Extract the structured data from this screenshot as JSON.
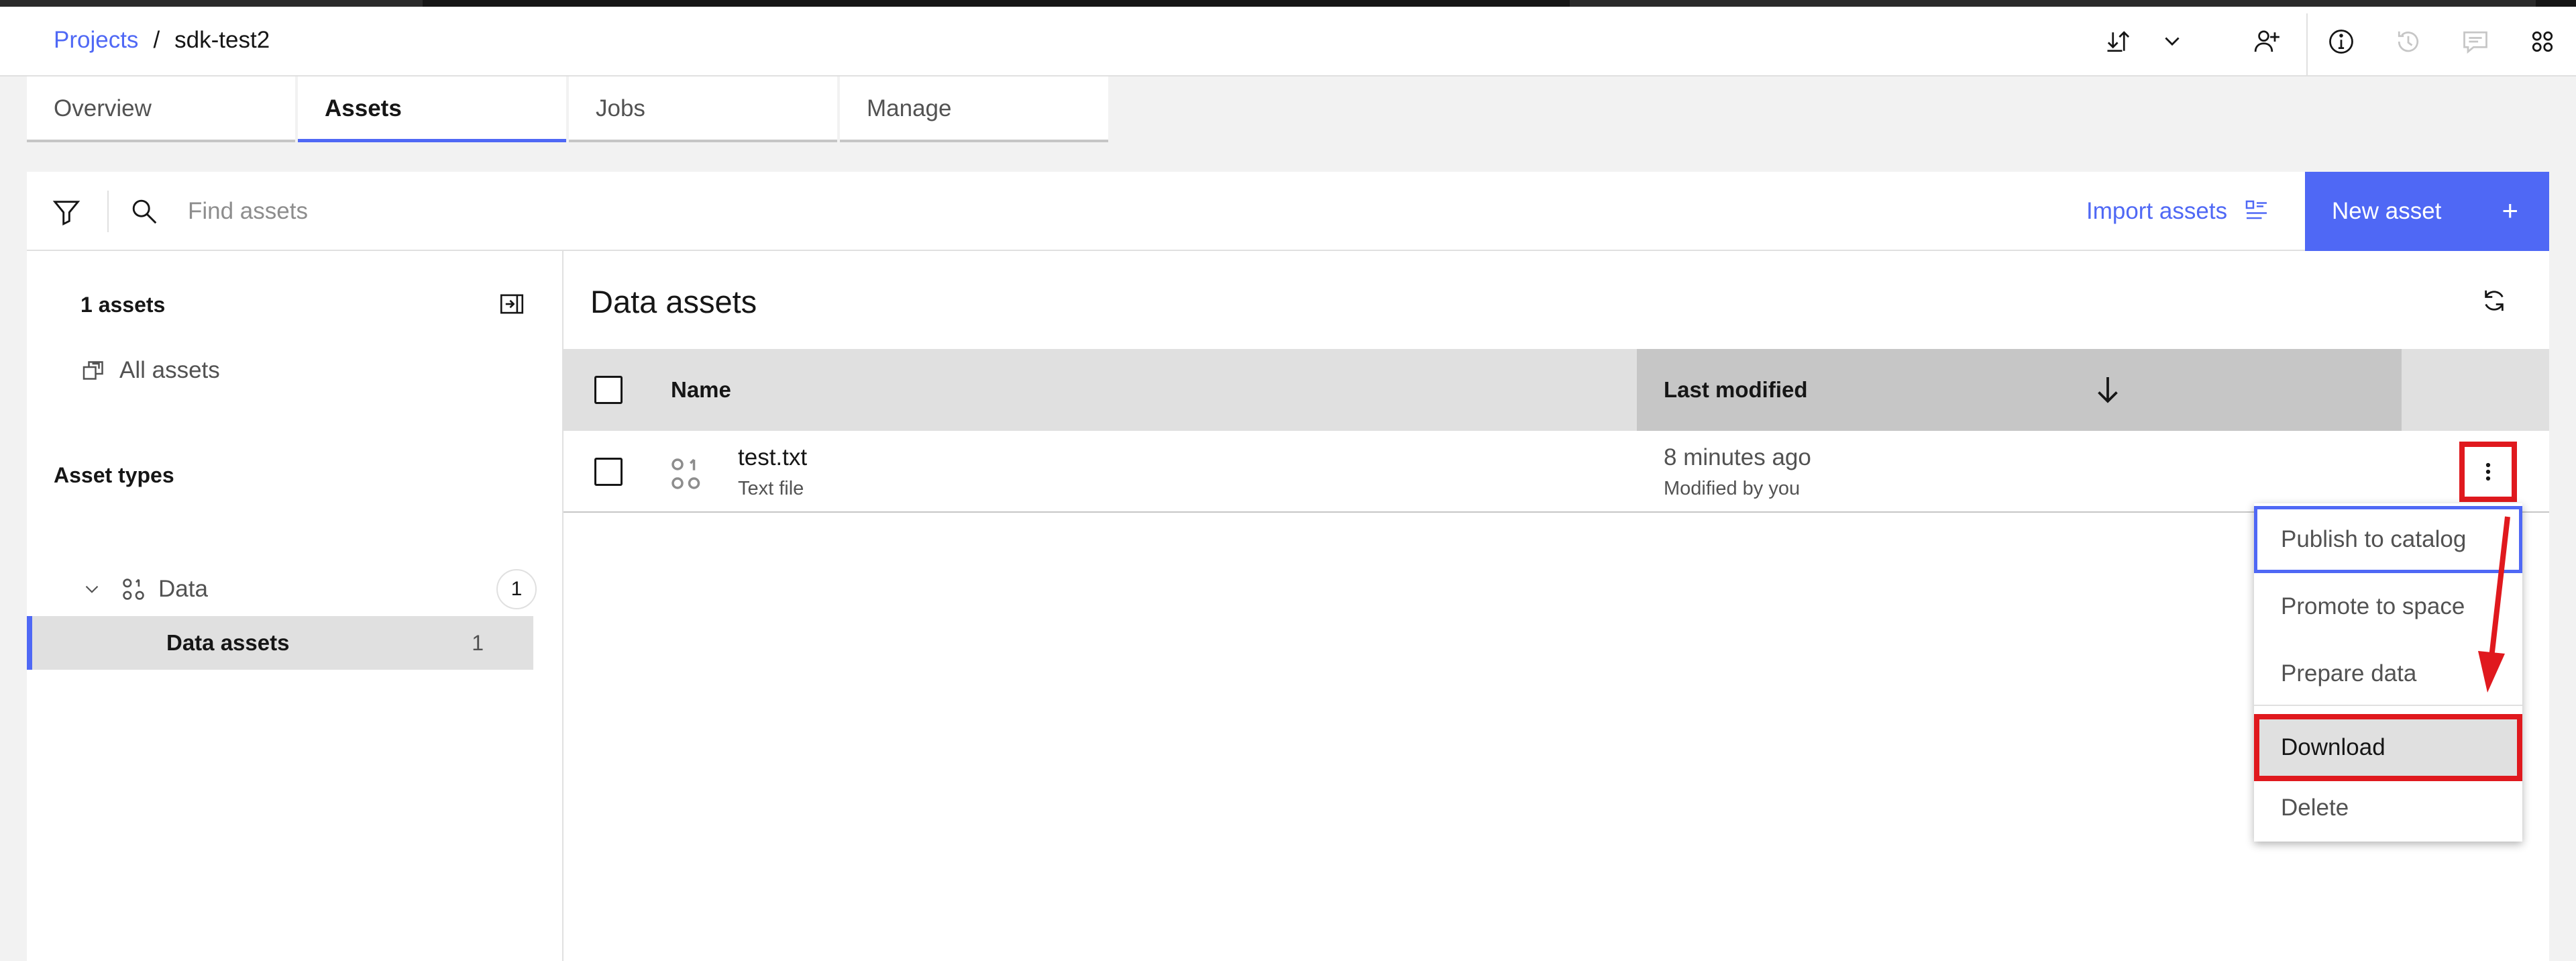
{
  "breadcrumb": {
    "projects": "Projects",
    "separator": "/",
    "current": "sdk-test2"
  },
  "header_icons": [
    "download-icon",
    "chevron-down-icon",
    "add-collaborator-icon",
    "info-icon",
    "history-icon",
    "comment-icon",
    "apps-icon"
  ],
  "tabs": [
    {
      "label": "Overview",
      "active": false
    },
    {
      "label": "Assets",
      "active": true
    },
    {
      "label": "Jobs",
      "active": false
    },
    {
      "label": "Manage",
      "active": false
    }
  ],
  "toolbar": {
    "search_placeholder": "Find assets",
    "import_label": "Import assets",
    "new_asset_label": "New asset",
    "new_asset_plus": "+"
  },
  "sidebar": {
    "asset_count": "1 assets",
    "all_assets": "All assets",
    "asset_types_heading": "Asset types",
    "category": {
      "label": "Data",
      "count": "1"
    },
    "subcategory": {
      "label": "Data assets",
      "count": "1"
    }
  },
  "main": {
    "title": "Data assets",
    "columns": {
      "name": "Name",
      "last_modified": "Last modified"
    },
    "rows": [
      {
        "name": "test.txt",
        "type": "Text file",
        "modified": "8 minutes ago",
        "modified_by": "Modified by you"
      }
    ]
  },
  "menu": {
    "items": [
      "Publish to catalog",
      "Promote to space",
      "Prepare data",
      "Download",
      "Delete"
    ]
  },
  "colors": {
    "accent": "#4f68f5",
    "annotation": "#e0191e"
  }
}
